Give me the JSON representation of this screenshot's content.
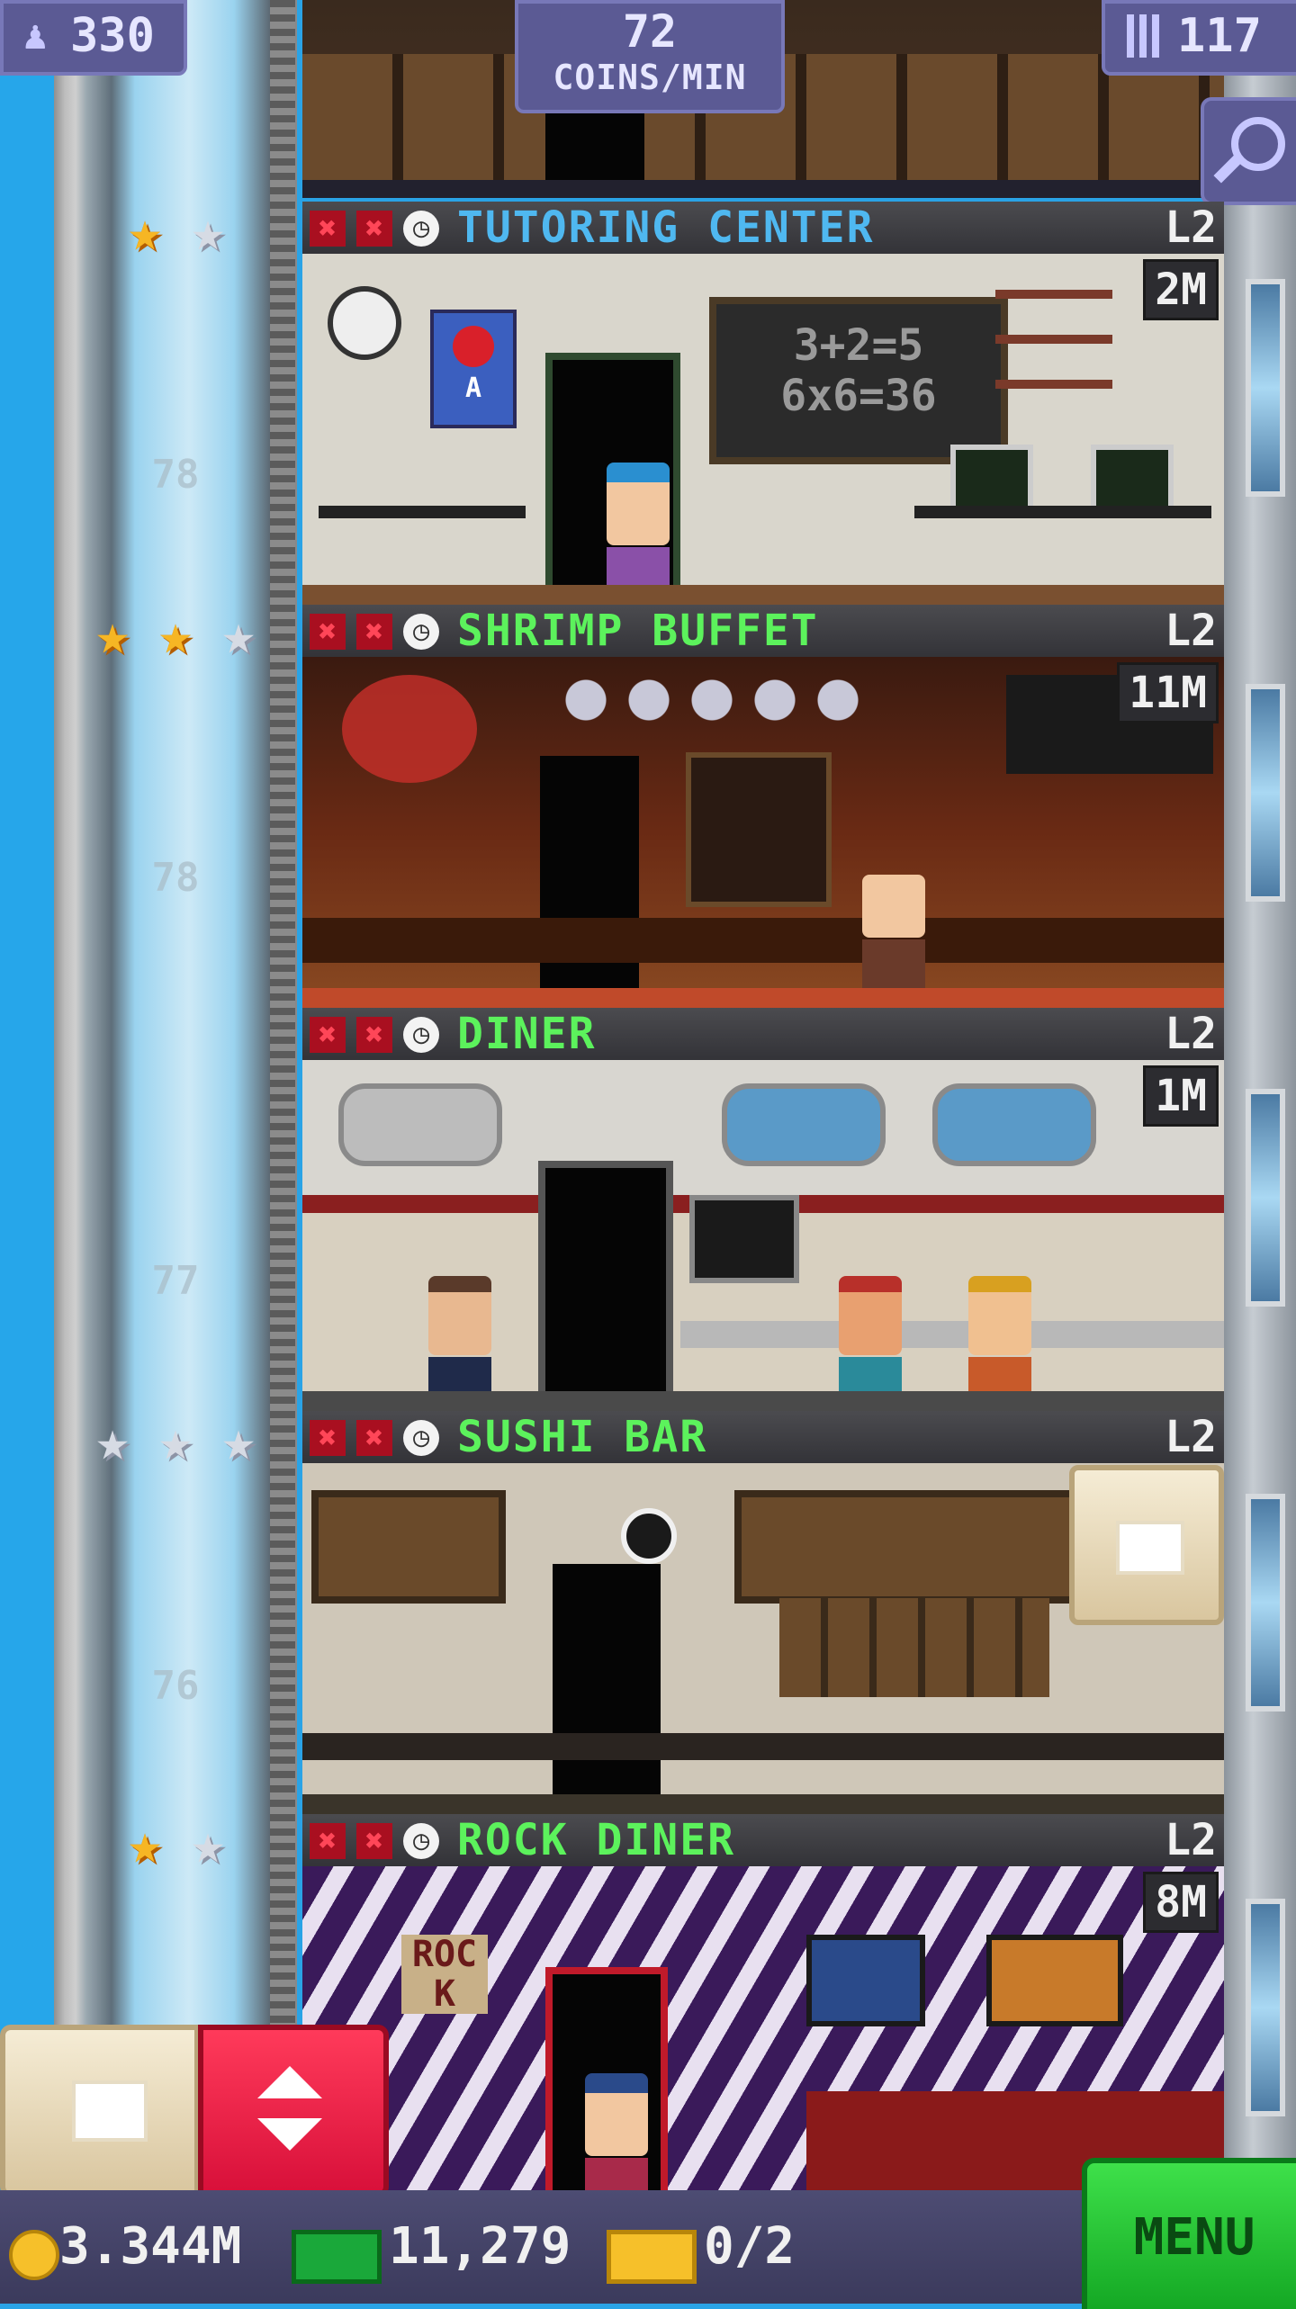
{
  "top_bar": {
    "population": "330",
    "rate_value": "72",
    "rate_unit": "COINS/MIN",
    "floors_count": "117"
  },
  "floor_numbers": [
    "78",
    "78",
    "77",
    "76"
  ],
  "floors": [
    {
      "name": "TUTORING CENTER",
      "level": "L2",
      "timer": "2M",
      "name_color": "#4fb8f0",
      "stars_gold": 1,
      "stars_total": 2,
      "scene_text": [
        "3+2=5",
        "6x6=36"
      ],
      "apple_sign_letter": "A"
    },
    {
      "name": "SHRIMP BUFFET",
      "level": "L2",
      "timer": "11M",
      "name_color": "#5cf25c",
      "stars_gold": 2,
      "stars_total": 3
    },
    {
      "name": "DINER",
      "level": "L2",
      "timer": "1M",
      "name_color": "#5cf25c",
      "stars_gold": 0,
      "stars_total": 0
    },
    {
      "name": "SUSHI BAR",
      "level": "L2",
      "timer": "",
      "name_color": "#5cf25c",
      "stars_gold": 0,
      "stars_total": 3
    },
    {
      "name": "ROCK DINER",
      "level": "L2",
      "timer": "8M",
      "name_color": "#5cf25c",
      "stars_gold": 1,
      "stars_total": 2,
      "sign_text": "ROCK"
    }
  ],
  "bottom_bar": {
    "coins": "3.344M",
    "bux": "11,279",
    "tickets": "0/2",
    "menu_label": "MENU"
  },
  "icons": {
    "person": "person-icon",
    "building": "building-icon",
    "search": "magnifier-icon",
    "coin": "coin-icon",
    "bux": "bux-icon",
    "ticket": "ticket-icon"
  }
}
